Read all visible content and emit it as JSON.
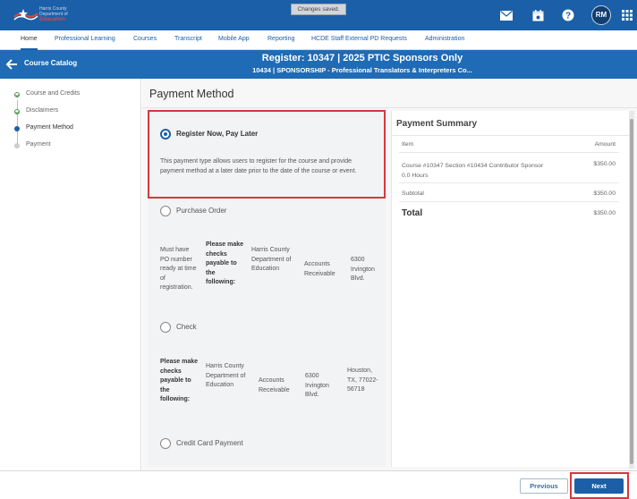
{
  "brand": {
    "line1": "Harris County",
    "line2": "Department of",
    "line3": "Education"
  },
  "toast": "Changes saved.",
  "user": {
    "initials": "RM"
  },
  "nav": {
    "items": [
      {
        "label": "Home",
        "active": true
      },
      {
        "label": "Professional Learning"
      },
      {
        "label": "Courses"
      },
      {
        "label": "Transcript"
      },
      {
        "label": "Mobile App"
      },
      {
        "label": "Reporting"
      },
      {
        "label": "HCDE Staff External PD Requests"
      },
      {
        "label": "Administration"
      }
    ]
  },
  "header": {
    "back_label": "Course Catalog",
    "title": "Register: 10347 | 2025 PTIC Sponsors Only",
    "subtitle": "10434 | SPONSORSHIP - Professional Translators & Interpreters Co..."
  },
  "steps": [
    {
      "label": "Course and Credits",
      "state": "done"
    },
    {
      "label": "Disclaimers",
      "state": "done"
    },
    {
      "label": "Payment Method",
      "state": "current"
    },
    {
      "label": "Payment",
      "state": "todo"
    }
  ],
  "page_title": "Payment Method",
  "options": {
    "register_later": {
      "label": "Register Now, Pay Later",
      "selected": true,
      "description": "This payment type allows users to register for the course and provide payment method at a later date prior to the date of the course or event."
    },
    "purchase_order": {
      "label": "Purchase Order",
      "cells": [
        "Must have PO number ready at time of registration.",
        "Please make checks payable to the following:",
        "Harris County Department of Education",
        "Accounts Receivable",
        "6300 Irvington Blvd."
      ]
    },
    "check": {
      "label": "Check",
      "cells": [
        "Please make checks payable to the following:",
        "Harris County Department of Education",
        "Accounts Receivable",
        "6300 Irvington Blvd.",
        "Houston, TX, 77022-56718"
      ]
    },
    "credit_card": {
      "label": "Credit Card Payment"
    }
  },
  "summary": {
    "title": "Payment Summary",
    "col_item": "Item",
    "col_amount": "Amount",
    "line_item": "Course #10347 Section #10434 Contributor Sponsor",
    "line_item_hours": "0.0 Hours",
    "line_amount": "$350.00",
    "subtotal_label": "Subtotal",
    "subtotal": "$350.00",
    "total_label": "Total",
    "total": "$350.00"
  },
  "footer": {
    "previous_label": "Previous",
    "next_label": "Next"
  },
  "colors": {
    "primary": "#1a5fa8",
    "header": "#1f6bb5",
    "highlight": "#d9363e"
  },
  "icons": [
    "mail-icon",
    "calendar-icon",
    "help-icon",
    "apps-grid-icon",
    "back-arrow-icon",
    "check-icon"
  ]
}
